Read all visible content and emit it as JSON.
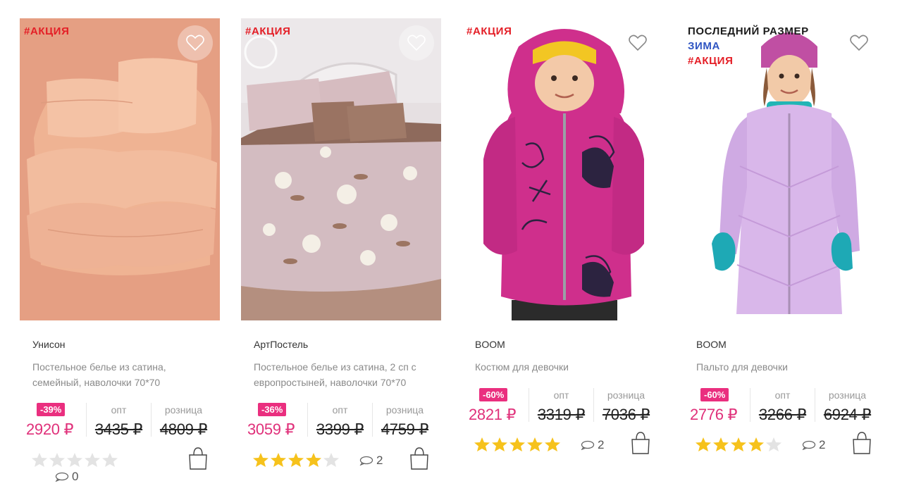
{
  "products": [
    {
      "tags": [
        "#АКЦИЯ"
      ],
      "brand": "Унисон",
      "description": "Постельное белье из сатина, семейный, наволочки 70*70",
      "discount": "-39%",
      "price": "2920 ₽",
      "opt_label": "опт",
      "opt_price": "3435 ₽",
      "retail_label": "розница",
      "retail_price": "4809 ₽",
      "rating": 0,
      "comments": "0",
      "favorite_icon": "heart-icon",
      "cart_icon": "shopping-bag-icon"
    },
    {
      "tags": [
        "#АКЦИЯ"
      ],
      "brand": "АртПостель",
      "description": "Постельное белье из сатина, 2 сп с европростыней, наволочки 70*70",
      "discount": "-36%",
      "price": "3059 ₽",
      "opt_label": "опт",
      "opt_price": "3399 ₽",
      "retail_label": "розница",
      "retail_price": "4759 ₽",
      "rating": 4,
      "comments": "2",
      "favorite_icon": "heart-icon",
      "cart_icon": "shopping-bag-icon"
    },
    {
      "tags": [
        "#АКЦИЯ"
      ],
      "brand": "BOOM",
      "description": "Костюм для девочки",
      "discount": "-60%",
      "price": "2821 ₽",
      "opt_label": "опт",
      "opt_price": "3319 ₽",
      "retail_label": "розница",
      "retail_price": "7036 ₽",
      "rating": 5,
      "comments": "2",
      "favorite_icon": "heart-icon",
      "cart_icon": "shopping-bag-icon"
    },
    {
      "tags": [
        "ПОСЛЕДНИЙ РАЗМЕР",
        "ЗИМА",
        "#АКЦИЯ"
      ],
      "brand": "BOOM",
      "description": "Пальто для девочки",
      "discount": "-60%",
      "price": "2776 ₽",
      "opt_label": "опт",
      "opt_price": "3266 ₽",
      "retail_label": "розница",
      "retail_price": "6924 ₽",
      "rating": 4,
      "comments": "2",
      "favorite_icon": "heart-icon",
      "cart_icon": "shopping-bag-icon"
    }
  ],
  "colors": {
    "sale_tag": "#e41e26",
    "season_tag": "#2f55c2",
    "discount_badge": "#ea2f7f",
    "price": "#e0307a",
    "star_filled": "#f6c21c",
    "star_empty": "#e3e3e3"
  }
}
